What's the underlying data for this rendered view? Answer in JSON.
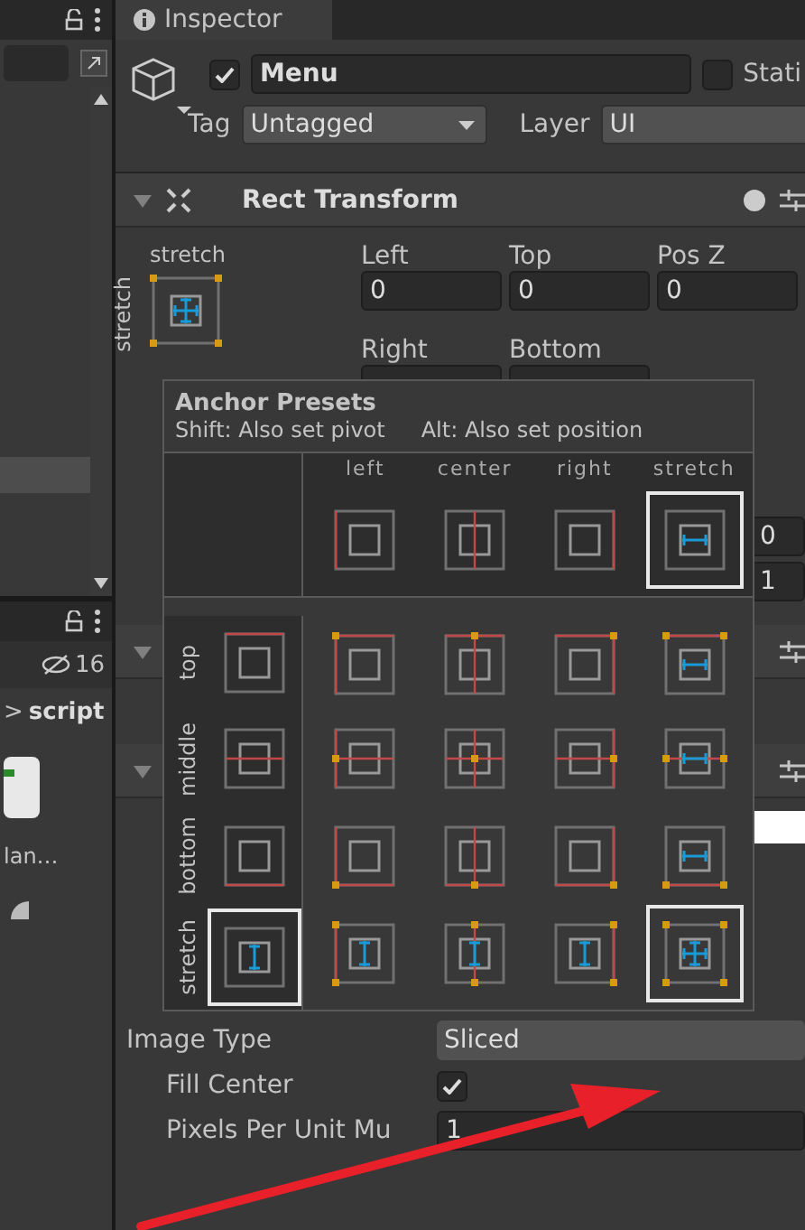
{
  "left_panel": {
    "hidden_count": "16",
    "breadcrumb_separator": ">",
    "breadcrumb": "script",
    "asset_label": "lan…"
  },
  "inspector": {
    "tab": "Inspector"
  },
  "object": {
    "active": true,
    "name": "Menu",
    "static": false,
    "static_label": "Stati",
    "tag_label": "Tag",
    "tag": "Untagged",
    "layer_label": "Layer",
    "layer": "UI"
  },
  "rect_transform": {
    "title": "Rect Transform",
    "expanded": true,
    "anchor_h": "stretch",
    "anchor_v": "stretch",
    "fields": [
      {
        "label": "Left",
        "value": "0"
      },
      {
        "label": "Top",
        "value": "0"
      },
      {
        "label": "Pos Z",
        "value": "0"
      },
      {
        "label": "Right"
      },
      {
        "label": "Bottom"
      }
    ],
    "side_values": [
      "0",
      "1"
    ]
  },
  "anchor_presets": {
    "title": "Anchor Presets",
    "hint_shift": "Shift: Also set pivot",
    "hint_alt": "Alt: Also set position",
    "columns": [
      {
        "label": "left",
        "kind": "left",
        "selected": false
      },
      {
        "label": "center",
        "kind": "center",
        "selected": false
      },
      {
        "label": "right",
        "kind": "right",
        "selected": false
      },
      {
        "label": "stretch",
        "kind": "stretch",
        "selected": true
      }
    ],
    "rows": [
      {
        "label": "top",
        "kind": "top",
        "cells": [
          {
            "selected": false
          },
          {
            "selected": false
          },
          {
            "selected": false
          },
          {
            "selected": false
          },
          {
            "selected": false
          }
        ]
      },
      {
        "label": "middle",
        "kind": "middle",
        "cells": [
          {
            "selected": false
          },
          {
            "selected": false
          },
          {
            "selected": false
          },
          {
            "selected": false
          },
          {
            "selected": false
          }
        ]
      },
      {
        "label": "bottom",
        "kind": "bottom",
        "cells": [
          {
            "selected": false
          },
          {
            "selected": false
          },
          {
            "selected": false
          },
          {
            "selected": false
          },
          {
            "selected": false
          }
        ]
      },
      {
        "label": "stretch",
        "kind": "stretch",
        "cells": [
          {
            "selected": true
          },
          {
            "selected": false
          },
          {
            "selected": false
          },
          {
            "selected": false
          },
          {
            "selected": true
          }
        ]
      }
    ]
  },
  "image": {
    "properties": [
      {
        "kind": "dropdown",
        "label": "Image Type",
        "value": "Sliced"
      },
      {
        "kind": "checkbox",
        "label": "Fill Center",
        "checked": true
      },
      {
        "kind": "number",
        "label": "Pixels Per Unit Mu",
        "value": "1"
      }
    ]
  }
}
